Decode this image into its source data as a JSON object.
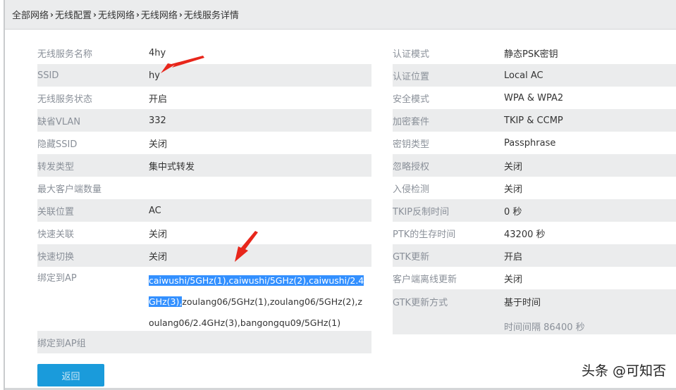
{
  "breadcrumb": [
    "全部网络",
    "无线配置",
    "无线网络",
    "无线网络",
    "无线服务详情"
  ],
  "left": [
    {
      "label": "无线服务名称",
      "value": "4hy"
    },
    {
      "label": "SSID",
      "value": "hy"
    },
    {
      "label": "无线服务状态",
      "value": "开启"
    },
    {
      "label": "缺省VLAN",
      "value": "332"
    },
    {
      "label": "隐藏SSID",
      "value": "关闭"
    },
    {
      "label": "转发类型",
      "value": "集中式转发"
    },
    {
      "label": "最大客户端数量",
      "value": ""
    },
    {
      "label": "关联位置",
      "value": "AC"
    },
    {
      "label": "快速关联",
      "value": "关闭"
    },
    {
      "label": "快速切换",
      "value": "关闭"
    }
  ],
  "bind_ap": {
    "label": "绑定到AP",
    "selected": "caiwushi/5GHz(1),caiwushi/5GHz(2),caiwushi/2.4GHz(3),",
    "rest": "zoulang06/5GHz(1),zoulang06/5GHz(2),zoulang06/2.4GHz(3),bangongqu09/5GHz(1)"
  },
  "bind_ap_group": {
    "label": "绑定到AP组",
    "value": ""
  },
  "right": [
    {
      "label": "认证模式",
      "value": "静态PSK密钥"
    },
    {
      "label": "认证位置",
      "value": "Local AC"
    },
    {
      "label": "安全模式",
      "value": "WPA & WPA2"
    },
    {
      "label": "加密套件",
      "value": "TKIP & CCMP"
    },
    {
      "label": "密钥类型",
      "value": "Passphrase"
    },
    {
      "label": "忽略授权",
      "value": "关闭"
    },
    {
      "label": "入侵检测",
      "value": "关闭"
    },
    {
      "label": "TKIP反制时间",
      "value": "0 秒"
    },
    {
      "label": "PTK的生存时间",
      "value": "43200 秒"
    },
    {
      "label": "GTK更新",
      "value": "开启"
    },
    {
      "label": "客户端离线更新",
      "value": "关闭"
    }
  ],
  "gtk_mode": {
    "label": "GTK更新方式",
    "value": "基于时间",
    "sub": "时间间隔 86400 秒"
  },
  "back_button": "返回",
  "watermark": "头条 @可知否",
  "colors": {
    "accent": "#1a9bdb",
    "selection": "#3390ff",
    "arrow": "#e8261b"
  }
}
